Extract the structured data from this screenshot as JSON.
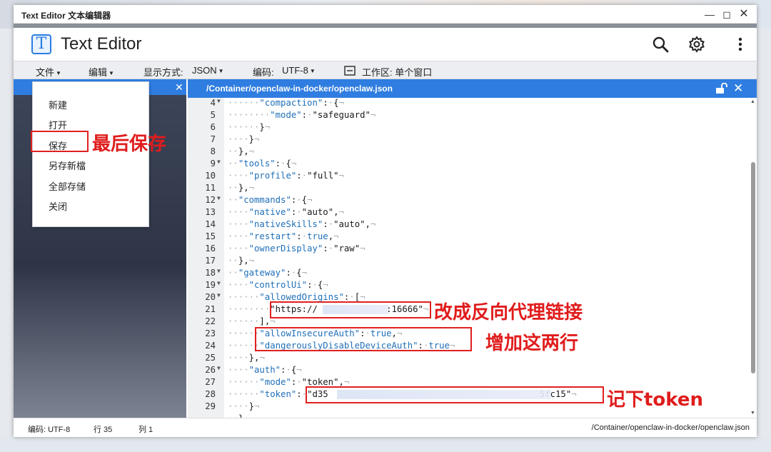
{
  "window": {
    "title": "Text Editor 文本编辑器"
  },
  "app": {
    "logo_letter": "T",
    "title": "Text Editor"
  },
  "menubar": {
    "file": "文件",
    "edit": "编辑",
    "display_label": "显示方式:",
    "display_value": "JSON",
    "encoding_label": "编码:",
    "encoding_value": "UTF-8",
    "workspace": "工作区: 单个窗口"
  },
  "file_menu": [
    "新建",
    "打开",
    "保存",
    "另存新檔",
    "全部存储",
    "关闭"
  ],
  "editor": {
    "path": "/Container/openclaw-in-docker/openclaw.json",
    "lines": [
      {
        "n": "4",
        "fold": true,
        "t": "······\"compaction\":·{¬"
      },
      {
        "n": "5",
        "fold": false,
        "t": "········\"mode\":·\"safeguard\"¬"
      },
      {
        "n": "6",
        "fold": false,
        "t": "······}¬"
      },
      {
        "n": "7",
        "fold": false,
        "t": "····}¬"
      },
      {
        "n": "8",
        "fold": false,
        "t": "··},¬"
      },
      {
        "n": "9",
        "fold": true,
        "t": "··\"tools\":·{¬"
      },
      {
        "n": "10",
        "fold": false,
        "t": "····\"profile\":·\"full\"¬"
      },
      {
        "n": "11",
        "fold": false,
        "t": "··},¬"
      },
      {
        "n": "12",
        "fold": true,
        "t": "··\"commands\":·{¬"
      },
      {
        "n": "13",
        "fold": false,
        "t": "····\"native\":·\"auto\",¬"
      },
      {
        "n": "14",
        "fold": false,
        "t": "····\"nativeSkills\":·\"auto\",¬"
      },
      {
        "n": "15",
        "fold": false,
        "t": "····\"restart\":·true,¬"
      },
      {
        "n": "16",
        "fold": false,
        "t": "····\"ownerDisplay\":·\"raw\"¬"
      },
      {
        "n": "17",
        "fold": false,
        "t": "··},¬"
      },
      {
        "n": "18",
        "fold": true,
        "t": "··\"gateway\":·{¬"
      },
      {
        "n": "19",
        "fold": true,
        "t": "····\"controlUi\":·{¬"
      },
      {
        "n": "20",
        "fold": true,
        "t": "······\"allowedOrigins\":·[¬"
      },
      {
        "n": "21",
        "fold": false,
        "t": "········\"https://             :16666\"¬"
      },
      {
        "n": "22",
        "fold": false,
        "t": "······],¬"
      },
      {
        "n": "23",
        "fold": false,
        "t": "······\"allowInsecureAuth\":·true,¬"
      },
      {
        "n": "24",
        "fold": false,
        "t": "······\"dangerouslyDisableDeviceAuth\":·true¬"
      },
      {
        "n": "25",
        "fold": false,
        "t": "····},¬"
      },
      {
        "n": "26",
        "fold": true,
        "t": "····\"auth\":·{¬"
      },
      {
        "n": "27",
        "fold": false,
        "t": "······\"mode\":·\"token\",¬"
      },
      {
        "n": "28",
        "fold": false,
        "t": "······\"token\":·\"d35                                        5fc15\"¬"
      },
      {
        "n": "29",
        "fold": false,
        "t": "····}¬"
      },
      {
        "n": "",
        "fold": false,
        "t": "··}"
      }
    ]
  },
  "statusbar": {
    "encoding": "编码: UTF-8",
    "row": "行 35",
    "col": "列 1",
    "path": "/Container/openclaw-in-docker/openclaw.json"
  },
  "annotations": {
    "save": "最后保存",
    "proxy": "改成反向代理链接",
    "add_lines": "增加这两行",
    "token": "记下token"
  },
  "colors": {
    "accent": "#2f7de0",
    "annotation": "#e01c1c"
  }
}
